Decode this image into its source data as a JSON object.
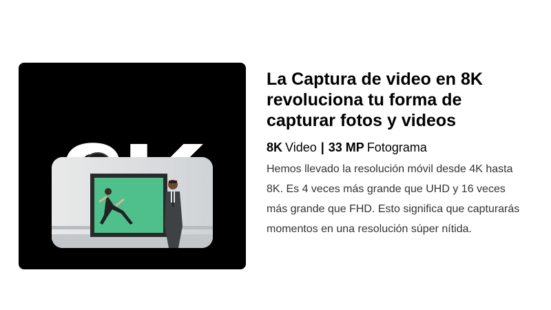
{
  "promo_image": {
    "big_label": "8K"
  },
  "headline": "La Captura de video en 8K revoluciona tu forma de capturar fotos y videos",
  "specs": {
    "video_value": "8K",
    "video_label": "Video",
    "divider": "|",
    "photo_value": "33 MP",
    "photo_label": "Fotograma"
  },
  "description": "Hemos llevado la resolución móvil desde 4K hasta 8K. Es 4 veces más grande que UHD y 16 veces más grande que FHD. Esto significa que capturarás momentos en una resolución súper nítida.",
  "colors": {
    "tile_background": "#000000",
    "screen_green": "#4fbf8c",
    "text": "#000000",
    "body_text": "#333333"
  },
  "icons": [
    "camera-lens-icon"
  ]
}
